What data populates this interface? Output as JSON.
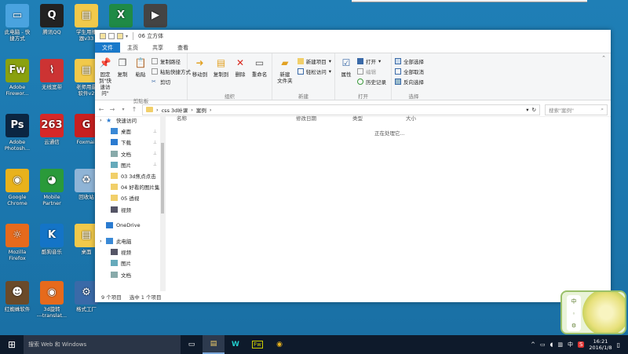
{
  "desktop": {
    "icons": [
      {
        "label": "此电脑 - 快\n捷方式",
        "glyph": "▭",
        "color": "#4aa3df"
      },
      {
        "label": "腾讯QQ",
        "glyph": "Q",
        "color": "#222"
      },
      {
        "label": "学生用播\n器v33",
        "glyph": "▤",
        "color": "#f1c94a"
      },
      {
        "label": "",
        "glyph": "X",
        "color": "#1f8a46"
      },
      {
        "label": "",
        "glyph": "▶",
        "color": "#444"
      },
      {
        "label": "Adobe\nFirewor...",
        "glyph": "Fw",
        "color": "#8aa10f"
      },
      {
        "label": "无线宽带",
        "glyph": "⌇",
        "color": "#c33"
      },
      {
        "label": "老师用最\n软件v2",
        "glyph": "▤",
        "color": "#f1c94a"
      },
      {
        "label": "Adobe\nPhotosh...",
        "glyph": "Ps",
        "color": "#0b2642"
      },
      {
        "label": "云通信",
        "glyph": "263",
        "color": "#d62828"
      },
      {
        "label": "Foxmail",
        "glyph": "G",
        "color": "#c81f1f"
      },
      {
        "label": "Google\nChrome",
        "glyph": "◉",
        "color": "#e8b21c"
      },
      {
        "label": "Mobile\nPartner",
        "glyph": "◕",
        "color": "#2a9a3a"
      },
      {
        "label": "回收站",
        "glyph": "♻",
        "color": "#8fb4d6"
      },
      {
        "label": "Mozilla\nFirefox",
        "glyph": "☼",
        "color": "#e66a1c"
      },
      {
        "label": "酷狗音乐",
        "glyph": "K",
        "color": "#1474c7"
      },
      {
        "label": "桌面",
        "glyph": "▤",
        "color": "#f1c94a"
      },
      {
        "label": "红蜘蛛软件",
        "glyph": "☻",
        "color": "#6a4a2a"
      },
      {
        "label": "3d旋转\n---translat...",
        "glyph": "◉",
        "color": "#e66a1c"
      },
      {
        "label": "格式工厂",
        "glyph": "⚙",
        "color": "#3a6aa8"
      }
    ]
  },
  "window": {
    "title": "06 立方体",
    "tabs": [
      "文件",
      "主页",
      "共享",
      "查看"
    ],
    "ribbon": {
      "clipboard": {
        "label": "剪贴板",
        "pin": "固定到\"快\n速访问\"",
        "copy": "复制",
        "paste": "粘贴",
        "copy_path": "复制路径",
        "paste_shortcut": "粘贴快捷方式",
        "cut": "剪切"
      },
      "organize": {
        "label": "组织",
        "move_to": "移动到",
        "copy_to": "复制到",
        "delete": "删除",
        "rename": "重命名"
      },
      "new": {
        "label": "新建",
        "new_folder": "新建\n文件夹",
        "new_item": "新建项目",
        "easy_access": "轻松访问"
      },
      "open": {
        "label": "打开",
        "properties": "属性",
        "open": "打开",
        "edit": "编辑",
        "history": "历史记录"
      },
      "select": {
        "label": "选择",
        "select_all": "全部选择",
        "select_none": "全部取消",
        "invert": "反向选择"
      }
    },
    "address": {
      "seg1": "css 3d补课",
      "seg2": "案例"
    },
    "search_placeholder": "搜索\"案例\"",
    "nav": [
      {
        "label": "快速访问",
        "type": "star",
        "pin": ""
      },
      {
        "label": "桌面",
        "type": "desktop",
        "pin": "📌"
      },
      {
        "label": "下载",
        "type": "download",
        "pin": "📌"
      },
      {
        "label": "文档",
        "type": "doc",
        "pin": "📌"
      },
      {
        "label": "图片",
        "type": "pic",
        "pin": "📌"
      },
      {
        "label": "03 3d焦点点击",
        "type": "folder",
        "pin": ""
      },
      {
        "label": "04 好看的图片集",
        "type": "folder",
        "pin": ""
      },
      {
        "label": "05 透视",
        "type": "folder",
        "pin": ""
      },
      {
        "label": "视频",
        "type": "video",
        "pin": ""
      },
      {
        "label": "",
        "type": "gap",
        "pin": ""
      },
      {
        "label": "OneDrive",
        "type": "cloud",
        "pin": ""
      },
      {
        "label": "",
        "type": "gap",
        "pin": ""
      },
      {
        "label": "此电脑",
        "type": "pc",
        "pin": ""
      },
      {
        "label": "视频",
        "type": "video",
        "pin": ""
      },
      {
        "label": "图片",
        "type": "pic",
        "pin": ""
      },
      {
        "label": "文档",
        "type": "doc",
        "pin": ""
      }
    ],
    "columns": [
      "名称",
      "修改日期",
      "类型",
      "大小"
    ],
    "loading": "正在处理它...",
    "status": {
      "count": "9 个项目",
      "selected": "选中 1 个项目"
    }
  },
  "widget": {
    "chars": [
      "中",
      "◦",
      "⚙"
    ]
  },
  "taskbar": {
    "search": "搜索 Web 和 Windows",
    "apps": [
      "▭",
      "▤",
      "W",
      "Fw",
      "◉"
    ],
    "tray_icons": [
      "^",
      "▭",
      "◖",
      "▥",
      "中",
      "S"
    ],
    "time": "16:21",
    "date": "2016/1/8"
  }
}
